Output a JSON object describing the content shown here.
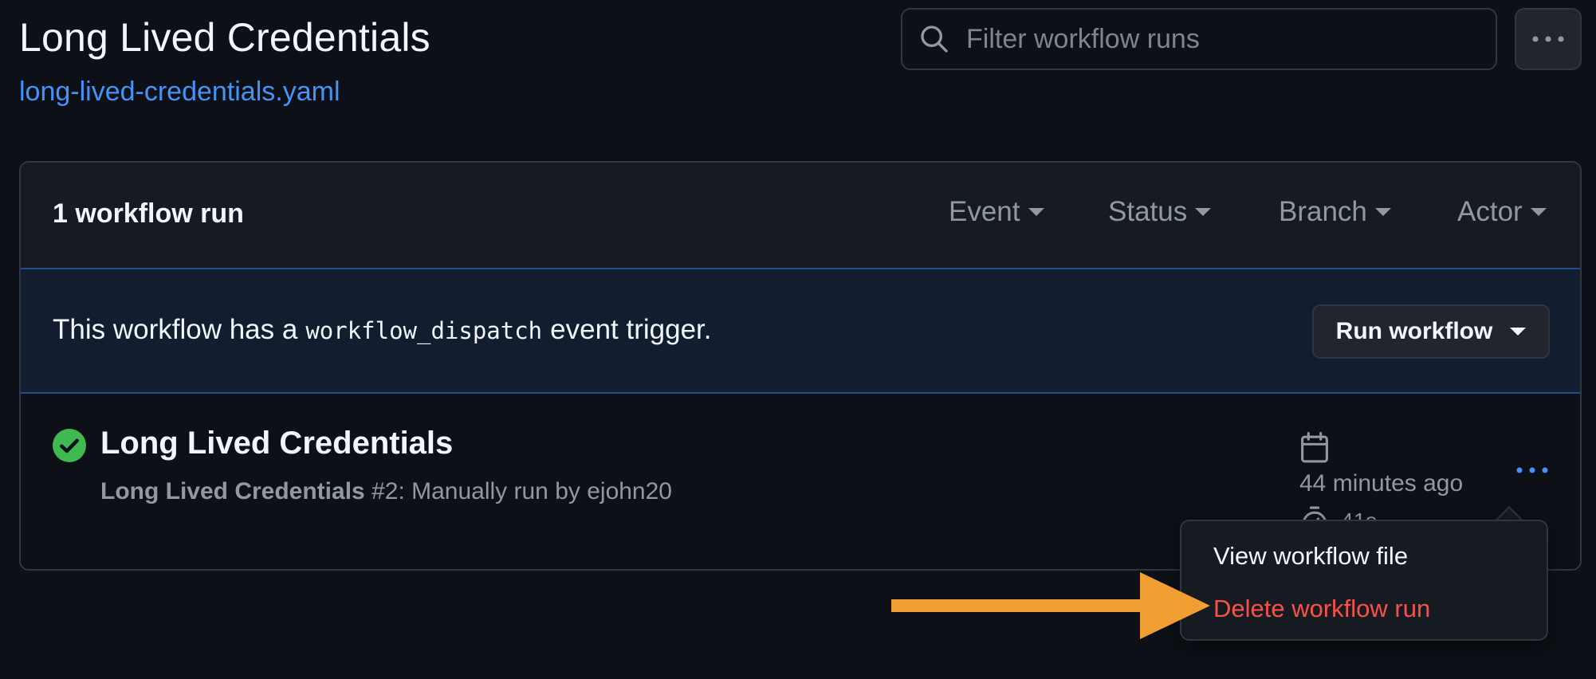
{
  "header": {
    "title": "Long Lived Credentials",
    "workflow_file": "long-lived-credentials.yaml",
    "filter_placeholder": "Filter workflow runs"
  },
  "runs_box": {
    "count_label": "1 workflow run",
    "filters": [
      "Event",
      "Status",
      "Branch",
      "Actor"
    ]
  },
  "dispatch_banner": {
    "text_before": "This workflow has a",
    "code": "workflow_dispatch",
    "text_after": "event trigger.",
    "run_button_label": "Run workflow"
  },
  "run": {
    "status": "success",
    "title": "Long Lived Credentials",
    "workflow_name": "Long Lived Credentials",
    "run_number": "#2",
    "trigger_text": ": Manually run by ejohn20",
    "time_ago": "44 minutes ago",
    "duration": "41s"
  },
  "menu": {
    "view_file_label": "View workflow file",
    "delete_label": "Delete workflow run"
  },
  "colors": {
    "background": "#0d1117",
    "link": "#4493f8",
    "success": "#3fb950",
    "danger": "#f85149",
    "annotation_arrow": "#f0a033"
  },
  "icons": [
    "search-icon",
    "kebab-icon",
    "check-circle-icon",
    "calendar-icon",
    "stopwatch-icon",
    "chevron-down-icon"
  ]
}
